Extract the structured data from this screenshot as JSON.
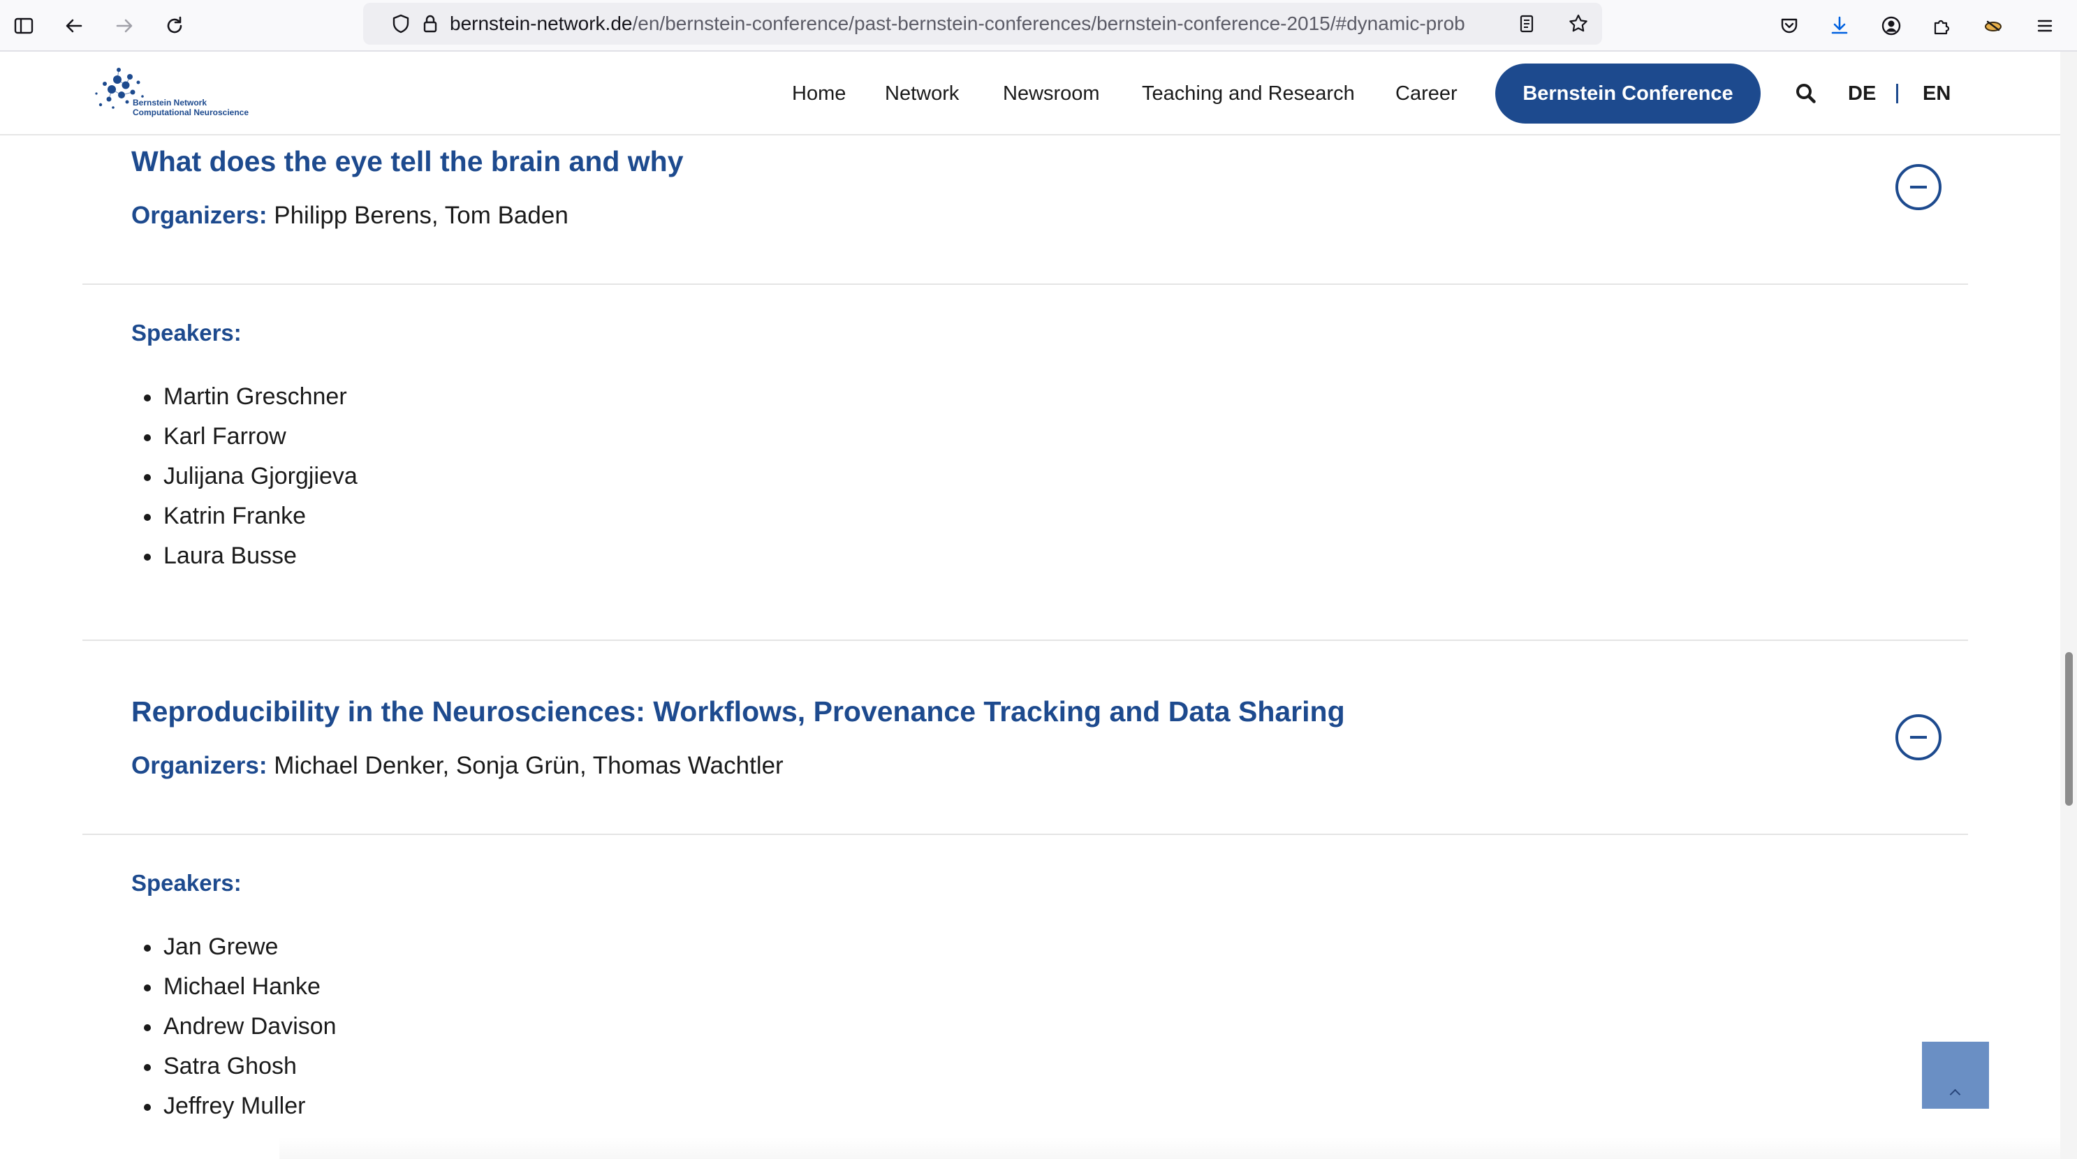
{
  "browser": {
    "url_host": "bernstein-network.de",
    "url_path": "/en/bernstein-conference/past-bernstein-conferences/bernstein-conference-2015/#dynamic-prob"
  },
  "header": {
    "logo_line1": "Bernstein Network",
    "logo_line2": "Computational Neuroscience",
    "nav": [
      "Home",
      "Network",
      "Newsroom",
      "Teaching and Research",
      "Career"
    ],
    "cta": "Bernstein Conference",
    "lang_de": "DE",
    "lang_en": "EN"
  },
  "sections": [
    {
      "title": "What does the eye tell the brain and why",
      "organizers_label": "Organizers:",
      "organizers": "Philipp Berens, Tom Baden",
      "speakers_label": "Speakers:",
      "speakers": [
        "Martin Greschner",
        "Karl Farrow",
        "Julijana Gjorgjieva",
        "Katrin Franke",
        "Laura Busse"
      ]
    },
    {
      "title": "Reproducibility in the Neurosciences: Workflows, Provenance Tracking and Data Sharing",
      "organizers_label": "Organizers:",
      "organizers": "Michael Denker, Sonja Grün, Thomas Wachtler",
      "speakers_label": "Speakers:",
      "speakers": [
        "Jan Grewe",
        "Michael Hanke",
        "Andrew Davison",
        "Satra Ghosh",
        "Jeffrey Muller"
      ]
    }
  ],
  "colors": {
    "brand": "#1d4a8e",
    "scroll_top_button": "#6a8fc4"
  },
  "icons": [
    "sidebar-icon",
    "back-icon",
    "forward-icon",
    "reload-icon",
    "shield-icon",
    "lock-icon",
    "reader-icon",
    "bookmark-star-icon",
    "pocket-icon",
    "download-icon",
    "account-icon",
    "extensions-icon",
    "extension-icon",
    "menu-icon",
    "search-icon",
    "collapse-icon",
    "arrow-up-icon"
  ]
}
